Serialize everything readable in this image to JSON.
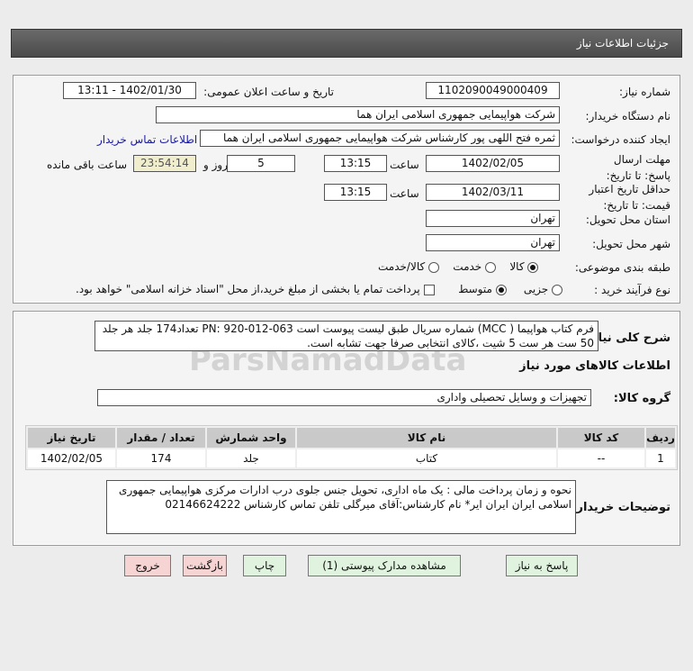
{
  "header": {
    "title": "جزئیات اطلاعات نیاز"
  },
  "form": {
    "need_number_label": "شماره نیاز:",
    "need_number": "1102090049000409",
    "announce_label": "تاریخ و ساعت اعلان عمومی:",
    "announce_value": "1402/01/30 - 13:11",
    "buyer_label": "نام دستگاه خریدار:",
    "buyer": "شرکت هواپیمایی جمهوری اسلامی ایران هما",
    "requester_label": "ایجاد کننده درخواست:",
    "requester": "ثمره فتح اللهی پور کارشناس شرکت هواپیمایی جمهوری اسلامی ایران هما",
    "contact_link": "اطلاعات تماس خریدار",
    "deadline_label": "مهلت ارسال پاسخ: تا تاریخ:",
    "deadline_date": "1402/02/05",
    "time_label": "ساعت",
    "deadline_time": "13:15",
    "days": "5",
    "days_label": "روز و",
    "remaining": "23:54:14",
    "remaining_label": "ساعت باقی مانده",
    "validity_label": "حداقل تاریخ اعتبار قیمت: تا تاریخ:",
    "validity_date": "1402/03/11",
    "validity_time": "13:15",
    "province_label": "استان محل تحویل:",
    "province": "تهران",
    "city_label": "شهر محل تحویل:",
    "city": "تهران",
    "category_label": "طبقه بندی موضوعی:",
    "category_options": [
      "کالا",
      "خدمت",
      "کالا/خدمت"
    ],
    "category_selected": "کالا",
    "process_label": "نوع فرآیند خرید :",
    "process_options": [
      "جزیی",
      "متوسط"
    ],
    "process_selected": "متوسط",
    "treasury_note": "پرداخت تمام یا بخشی از مبلغ خرید،از محل \"اسناد خزانه اسلامی\" خواهد بود."
  },
  "details": {
    "description_label": "شرح کلی نیاز:",
    "description": "فرم کتاب هواپیما ( MCC) شماره سریال طبق لیست پیوست است PN: 920-012-063 تعداد174 جلد هر جلد 50 ست هر ست 5 شیت ،کالای انتخابی صرفا جهت تشابه است.",
    "goods_info_title": "اطلاعات کالاهای مورد نیاز",
    "group_label": "گروه کالا:",
    "group": "تجهیزات و وسایل تحصیلی واداری",
    "table": {
      "headers": [
        "ردیف",
        "کد کالا",
        "نام کالا",
        "واحد شمارش",
        "تعداد / مقدار",
        "تاریخ نیاز"
      ],
      "rows": [
        [
          "1",
          "--",
          "کتاب",
          "جلد",
          "174",
          "1402/02/05"
        ]
      ]
    },
    "notes_label": "توضیحات خریدار:",
    "notes": "نحوه و زمان پرداخت مالی  : یک  ماه اداری، تحویل جنس جلوی درب ادارات مرکزی هواپیمایی جمهوری اسلامی ایران ایران ایر* نام کارشناس:آقای میرگلی تلفن تماس کارشناس 02146624222"
  },
  "buttons": {
    "reply": "پاسخ به نیاز",
    "attachments": "مشاهده مدارک پیوستی (1)",
    "print": "چاپ",
    "back": "بازگشت",
    "exit": "خروج"
  },
  "watermark": "ParsNamadData",
  "colors": {
    "header": "#555555",
    "link": "#1a1aa6",
    "countdown_bg": "#f0eecc",
    "button": "#dff3df",
    "button_alt": "#f7d4d4"
  }
}
